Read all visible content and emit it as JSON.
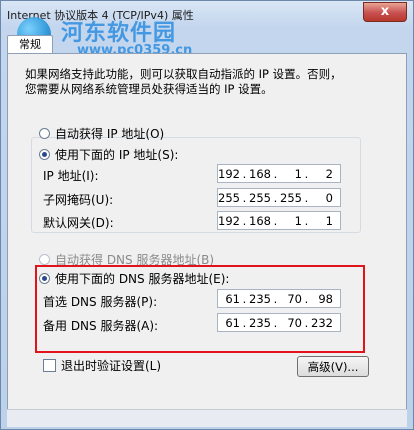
{
  "window": {
    "title": "Internet 协议版本 4 (TCP/IPv4) 属性",
    "close_label": "x"
  },
  "watermark": {
    "site_name": "河东软件园",
    "url": "www.pc0359.cn"
  },
  "tabs": [
    {
      "label": "常规"
    }
  ],
  "description": [
    "如果网络支持此功能，则可以获取自动指派的 IP 设置。否则，",
    "您需要从网络系统管理员处获得适当的 IP 设置。"
  ],
  "ip_section": {
    "auto_label": "自动获得 IP 地址(O)",
    "manual_label": "使用下面的 IP 地址(S):",
    "fields": [
      {
        "label": "IP 地址(I):",
        "octets": [
          "192",
          "168",
          "1",
          "2"
        ]
      },
      {
        "label": "子网掩码(U):",
        "octets": [
          "255",
          "255",
          "255",
          "0"
        ]
      },
      {
        "label": "默认网关(D):",
        "octets": [
          "192",
          "168",
          "1",
          "1"
        ]
      }
    ]
  },
  "dns_section": {
    "auto_label": "自动获得 DNS 服务器地址(B)",
    "manual_label": "使用下面的 DNS 服务器地址(E):",
    "fields": [
      {
        "label": "首选 DNS 服务器(P):",
        "octets": [
          "61",
          "235",
          "70",
          "98"
        ]
      },
      {
        "label": "备用 DNS 服务器(A):",
        "octets": [
          "61",
          "235",
          "70",
          "232"
        ]
      }
    ]
  },
  "validate_label": "退出时验证设置(L)",
  "advanced_label": "高级(V)...",
  "colors": {
    "highlight_box": "#e0141a",
    "selected_radio": "#2a4b8a"
  }
}
